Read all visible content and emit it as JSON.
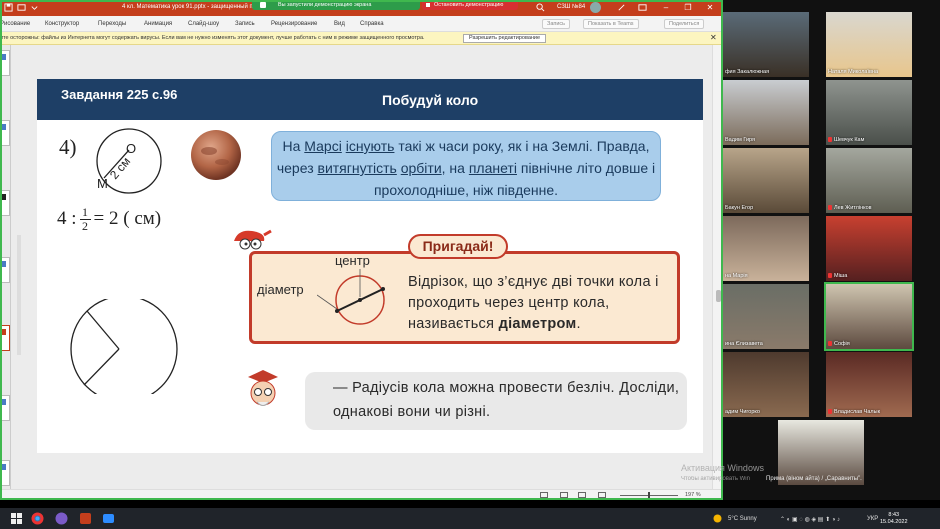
{
  "window": {
    "doc_title": "4 кл. Математика урок 91.pptx  -  защищенный просмотр",
    "share_banner": "Вы запустили демонстрацию экрана",
    "stop_demo": "Остановить демонстрацию",
    "user_name": "СЗШ №84"
  },
  "menu": {
    "items": [
      "Рисование",
      "Конструктор",
      "Переходы",
      "Анимация",
      "Слайд-шоу",
      "Запись",
      "Рецензирование",
      "Вид",
      "Справка"
    ],
    "right_buttons": [
      "Запись",
      "Показать в Teams",
      "Поделиться"
    ]
  },
  "warning": {
    "text": "ите осторожны: файлы из Интернета могут содержать вирусы. Если вам не нужно изменять этот документ, лучше работать с ним в режиме защищенного просмотра.",
    "enable_button": "Разрешить редактирование",
    "close": "✕"
  },
  "slide": {
    "task": "Завдання  225 с.96",
    "title": "Побудуй коло",
    "item_number": "4)",
    "circle_label_m": "M",
    "circle_label_radius": "2 см",
    "circle_label_o": "O",
    "formula": {
      "left": "4 :",
      "num": "1",
      "den": "2",
      "right": "= 2 ( см)"
    },
    "mars_text": {
      "part1": "На ",
      "mars": "Марсі",
      "part2": " ",
      "exist": "існують",
      "part3": " такі ж часи року, як і на Землі. Правда, через ",
      "elong": "витягнутість",
      "part4": " ",
      "orbit": "орбіти",
      "part5": ", на ",
      "planet": "планеті",
      "part6": " північне літо довше і прохолодніше, ніж південне."
    },
    "remind_tag": "Пригадай!",
    "label_center": "центр",
    "label_diameter": "діаметр",
    "remind_text_plain": "Відрізок, що з’єднує дві точки кола і проходить через центр кола, називається ",
    "remind_text_bold": "діаметром",
    "remind_text_end": ".",
    "radius_text": "— Радіусів кола можна провести безліч. Досліди, однакові вони чи різні."
  },
  "statusbar": {
    "zoom": "197 %"
  },
  "participants": [
    {
      "name": "фия Закалюжная"
    },
    {
      "name": "Наталя Миколаївна"
    },
    {
      "name": "Вадим Гиря"
    },
    {
      "name": "Шевчук Кам"
    },
    {
      "name": "Бакун Егор"
    },
    {
      "name": "Лев Житлінков"
    },
    {
      "name": "на Марія"
    },
    {
      "name": "Міша"
    },
    {
      "name": "ина Єлизавета"
    },
    {
      "name": "Софія"
    },
    {
      "name": "адим Чигорко"
    },
    {
      "name": "Владислав Чалык"
    },
    {
      "name": ""
    }
  ],
  "overlay": {
    "activate_title": "Активация Windows",
    "activate_sub": "Чтобы активировать Win",
    "caption": "Прима (віном айта) / „Саравниты”."
  },
  "taskbar": {
    "weather": "5°C  Sunny",
    "lang": "УКР",
    "time": "8:43",
    "date": "15.04.2022"
  },
  "colors": {
    "ppt_red": "#c43e1c",
    "header_blue": "#1e3f66",
    "demo_green": "#3fb84e"
  }
}
